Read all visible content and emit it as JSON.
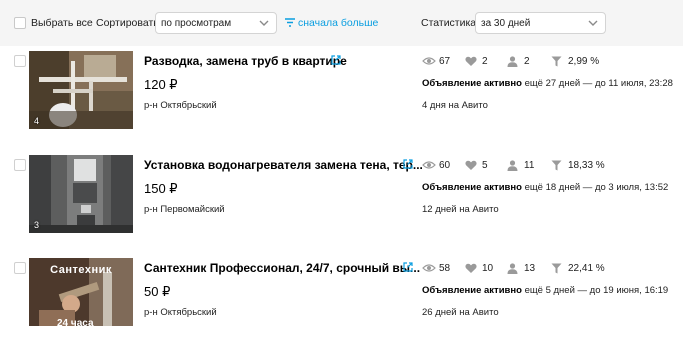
{
  "toolbar": {
    "select_all_label": "Выбрать все",
    "sort_label": "Сортировать",
    "sort_value": "по просмотрам",
    "sort_direction_label": "сначала больше",
    "stats_label": "Статистика",
    "stats_period": "за 30 дней"
  },
  "listings": [
    {
      "title": "Разводка, замена труб в квартире",
      "price": "120 ₽",
      "district": "р-н Октябрьский",
      "photo_count": "4",
      "thumb_overlay_top": "",
      "thumb_overlay_bottom": "",
      "views": "67",
      "favorites": "2",
      "contacts": "2",
      "conversion": "2,99 %",
      "status_bold": "Объявление активно",
      "status_rest": "ещё 27 дней — до 11 июля, 23:28",
      "days_on_site": "4 дня на Авито"
    },
    {
      "title": "Установка водонагревателя замена тена, тер...",
      "price": "150 ₽",
      "district": "р-н Первомайский",
      "photo_count": "3",
      "thumb_overlay_top": "",
      "thumb_overlay_bottom": "",
      "views": "60",
      "favorites": "5",
      "contacts": "11",
      "conversion": "18,33 %",
      "status_bold": "Объявление активно",
      "status_rest": "ещё 18 дней — до 3 июля, 13:52",
      "days_on_site": "12 дней на Авито"
    },
    {
      "title": "Сантехник Профессионал, 24/7, срочный вы...",
      "price": "50 ₽",
      "district": "р-н Октябрьский",
      "photo_count": "",
      "thumb_overlay_top": "Сантехник",
      "thumb_overlay_bottom": "24 часа",
      "views": "58",
      "favorites": "10",
      "contacts": "13",
      "conversion": "22,41 %",
      "status_bold": "Объявление активно",
      "status_rest": "ещё 5 дней — до 19 июня, 16:19",
      "days_on_site": "26 дней на Авито"
    }
  ],
  "colors": {
    "accent": "#0a9ee0",
    "icon_gray": "#9a9a9a",
    "toolbar_bg": "#f5f5f5"
  },
  "icons": {
    "views": "eye-icon",
    "favorites": "heart-icon",
    "contacts": "person-icon",
    "conversion": "funnel-icon",
    "open": "external-link-icon",
    "dropdown": "chevron-down-icon",
    "sort": "sort-descending-icon"
  }
}
